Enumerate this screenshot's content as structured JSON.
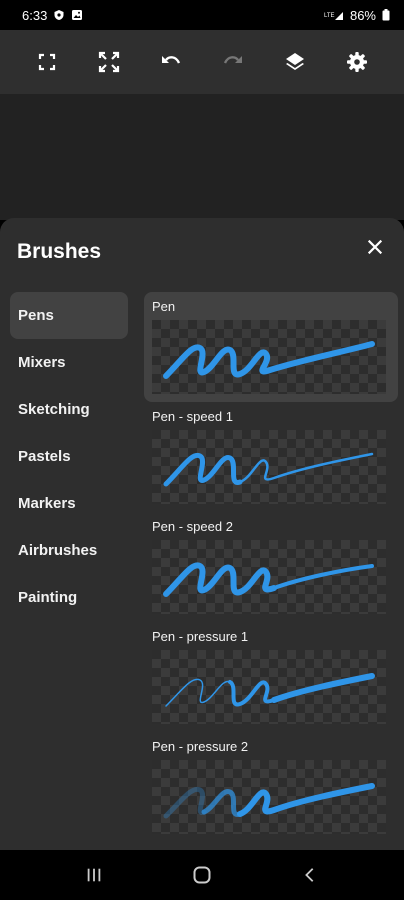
{
  "status_bar": {
    "time": "6:33",
    "battery": "86%",
    "icons": [
      "shield-icon",
      "gallery-icon",
      "signal-icon",
      "battery-icon"
    ]
  },
  "toolbar": {
    "buttons": [
      "fullscreen-icon",
      "expand-icon",
      "undo-icon",
      "redo-icon",
      "layers-icon",
      "settings-icon"
    ]
  },
  "sheet": {
    "title": "Brushes",
    "close_icon": "close-icon"
  },
  "categories": [
    {
      "label": "Pens",
      "active": true
    },
    {
      "label": "Mixers",
      "active": false
    },
    {
      "label": "Sketching",
      "active": false
    },
    {
      "label": "Pastels",
      "active": false
    },
    {
      "label": "Markers",
      "active": false
    },
    {
      "label": "Airbrushes",
      "active": false
    },
    {
      "label": "Painting",
      "active": false
    }
  ],
  "brushes": [
    {
      "label": "Pen",
      "active": true
    },
    {
      "label": "Pen - speed 1",
      "active": false
    },
    {
      "label": "Pen - speed 2",
      "active": false
    },
    {
      "label": "Pen - pressure 1",
      "active": false
    },
    {
      "label": "Pen - pressure 2",
      "active": false
    }
  ],
  "colors": {
    "stroke": "#2f95e8",
    "sheet_bg": "#2e2e2e",
    "toolbar_bg": "#2f2f2f",
    "active_bg": "#424242"
  },
  "nav_bar": [
    "recents-icon",
    "home-icon",
    "back-icon"
  ]
}
